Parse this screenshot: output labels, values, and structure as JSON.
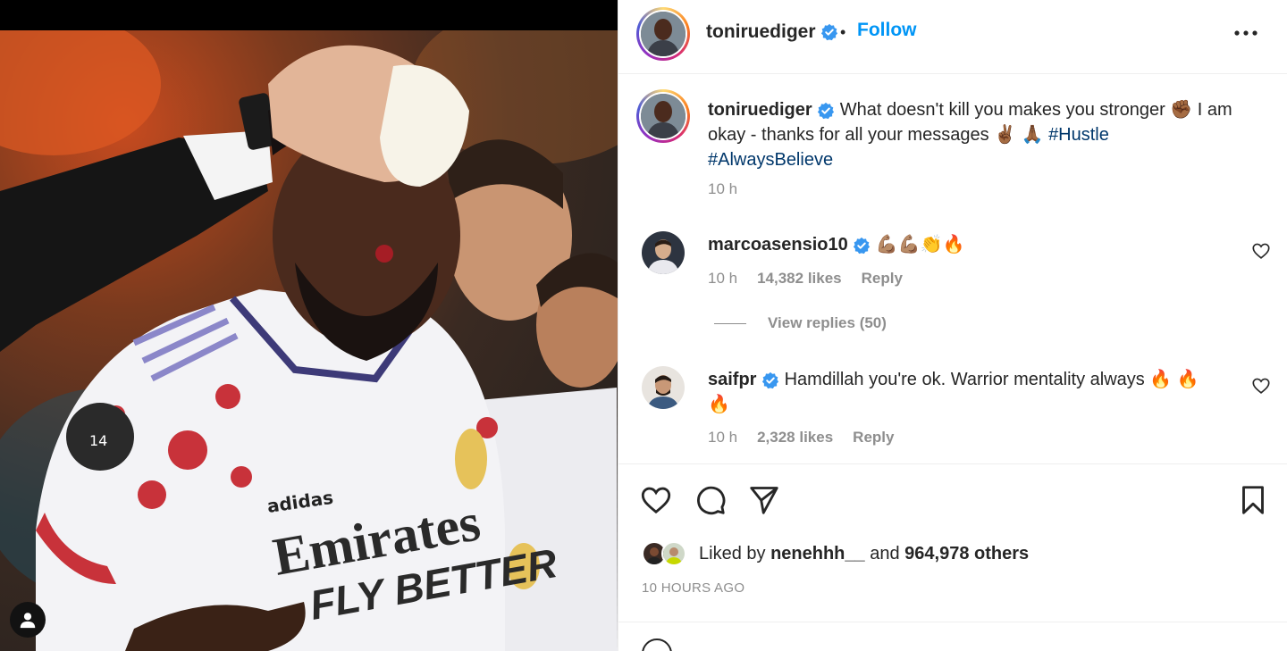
{
  "post": {
    "author": "toniruediger",
    "follow_label": "Follow",
    "separator": "•",
    "caption_text": "What doesn't kill you makes you stronger ✊🏾 I am okay - thanks for all your messages ✌🏾 🙏🏾",
    "hashtags": [
      "#Hustle",
      "#AlwaysBelieve"
    ],
    "caption_time": "10 h"
  },
  "comments": [
    {
      "user": "marcoasensio10",
      "text": "💪🏽💪🏽👏🔥",
      "time": "10 h",
      "likes": "14,382 likes",
      "reply_label": "Reply",
      "view_replies": "View replies (50)"
    },
    {
      "user": "saifpr",
      "text": "Hamdillah you're ok. Warrior mentality always 🔥 🔥 🔥",
      "time": "10 h",
      "likes": "2,328 likes",
      "reply_label": "Reply"
    }
  ],
  "likes": {
    "prefix": "Liked by",
    "user": "nenehhh__",
    "joiner": "and",
    "others": "964,978 others"
  },
  "timestamp": "10 HOURS AGO",
  "icons": {
    "more": "more-horizontal-icon",
    "verified": "verified-badge-icon",
    "like": "heart-icon",
    "comment": "comment-bubble-icon",
    "share": "paper-plane-icon",
    "save": "bookmark-icon",
    "user_tag": "person-icon",
    "emoji": "emoji-icon"
  },
  "colors": {
    "link_blue": "#0095f6",
    "hashtag": "#00376b",
    "secondary_text": "#8e8e8e",
    "verified": "#3897f0"
  }
}
